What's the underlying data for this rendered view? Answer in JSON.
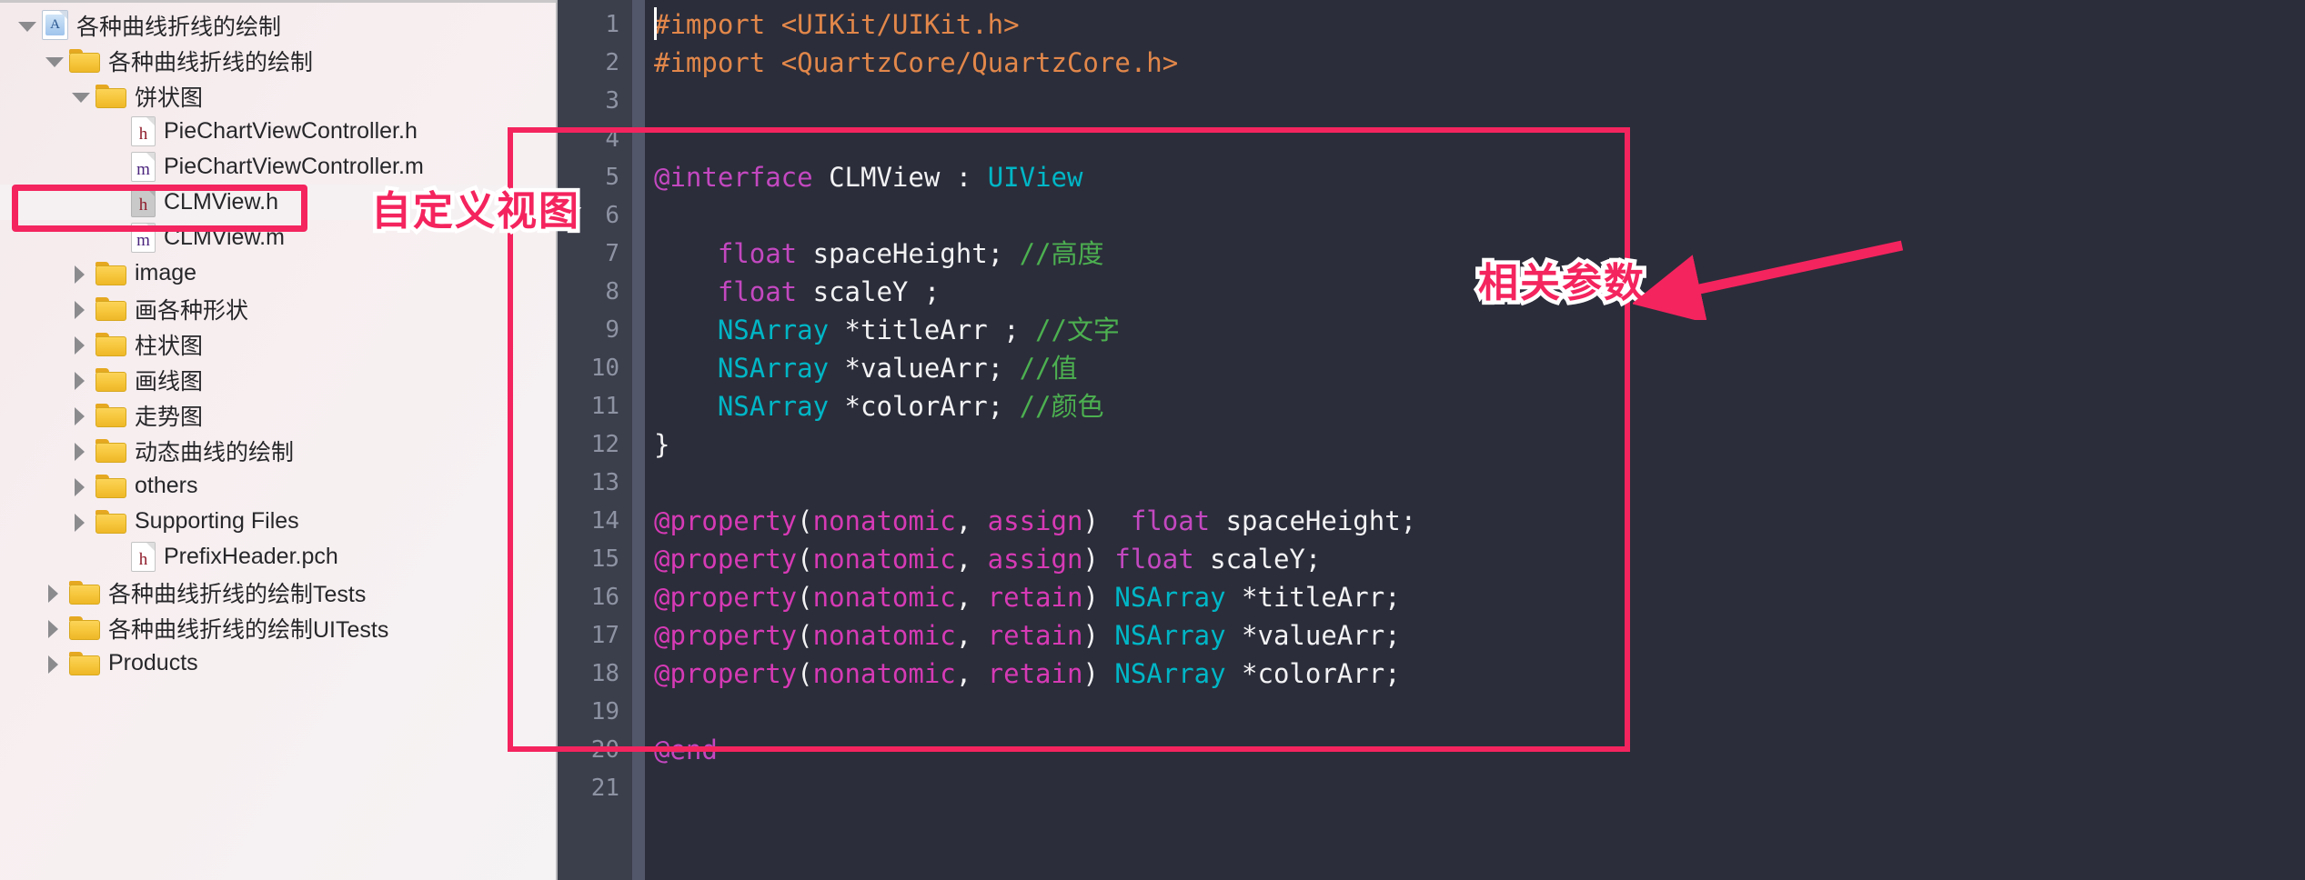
{
  "app": {
    "kind": "xcode-project-navigator-with-editor"
  },
  "sidebar": {
    "items": [
      {
        "label": "各种曲线折线的绘制",
        "icon": "project-icon",
        "indent": 0,
        "twisty": "open",
        "type": "project"
      },
      {
        "label": "各种曲线折线的绘制",
        "icon": "folder-icon",
        "indent": 1,
        "twisty": "open",
        "type": "folder"
      },
      {
        "label": "饼状图",
        "icon": "folder-icon",
        "indent": 2,
        "twisty": "open",
        "type": "folder"
      },
      {
        "label": "PieChartViewController.h",
        "icon": "header-file-icon",
        "indent": 3,
        "twisty": "none",
        "type": "file-h"
      },
      {
        "label": "PieChartViewController.m",
        "icon": "implementation-file-icon",
        "indent": 3,
        "twisty": "none",
        "type": "file-m"
      },
      {
        "label": "CLMView.h",
        "icon": "header-file-icon",
        "indent": 3,
        "twisty": "none",
        "type": "file-h-selected",
        "selected": true
      },
      {
        "label": "CLMView.m",
        "icon": "implementation-file-icon",
        "indent": 3,
        "twisty": "none",
        "type": "file-m"
      },
      {
        "label": "image",
        "icon": "folder-icon",
        "indent": 2,
        "twisty": "closed",
        "type": "folder"
      },
      {
        "label": "画各种形状",
        "icon": "folder-icon",
        "indent": 2,
        "twisty": "closed",
        "type": "folder"
      },
      {
        "label": "柱状图",
        "icon": "folder-icon",
        "indent": 2,
        "twisty": "closed",
        "type": "folder"
      },
      {
        "label": "画线图",
        "icon": "folder-icon",
        "indent": 2,
        "twisty": "closed",
        "type": "folder"
      },
      {
        "label": "走势图",
        "icon": "folder-icon",
        "indent": 2,
        "twisty": "closed",
        "type": "folder"
      },
      {
        "label": "动态曲线的绘制",
        "icon": "folder-icon",
        "indent": 2,
        "twisty": "closed",
        "type": "folder"
      },
      {
        "label": "others",
        "icon": "folder-icon",
        "indent": 2,
        "twisty": "closed",
        "type": "folder"
      },
      {
        "label": "Supporting Files",
        "icon": "folder-icon",
        "indent": 2,
        "twisty": "closed",
        "type": "folder"
      },
      {
        "label": "PrefixHeader.pch",
        "icon": "header-file-icon",
        "indent": 3,
        "twisty": "none",
        "type": "file-h"
      },
      {
        "label": "各种曲线折线的绘制Tests",
        "icon": "folder-icon",
        "indent": 1,
        "twisty": "closed",
        "type": "folder"
      },
      {
        "label": "各种曲线折线的绘制UITests",
        "icon": "folder-icon",
        "indent": 1,
        "twisty": "closed",
        "type": "folder"
      },
      {
        "label": "Products",
        "icon": "folder-icon",
        "indent": 1,
        "twisty": "closed",
        "type": "folder"
      }
    ]
  },
  "editor": {
    "line_numbers": [
      "1",
      "2",
      "3",
      "4",
      "5",
      "6",
      "7",
      "8",
      "9",
      "10",
      "11",
      "12",
      "13",
      "14",
      "15",
      "16",
      "17",
      "18",
      "19",
      "20",
      "21"
    ],
    "lines": [
      {
        "n": "1",
        "tokens": [
          {
            "t": "#import ",
            "c": "pre"
          },
          {
            "t": "<UIKit/UIKit.h>",
            "c": "pre"
          }
        ]
      },
      {
        "n": "2",
        "tokens": [
          {
            "t": "#import ",
            "c": "pre"
          },
          {
            "t": "<QuartzCore/QuartzCore.h>",
            "c": "pre"
          }
        ]
      },
      {
        "n": "3",
        "tokens": []
      },
      {
        "n": "4",
        "tokens": []
      },
      {
        "n": "5",
        "tokens": [
          {
            "t": "@interface",
            "c": "kw"
          },
          {
            "t": " ",
            "c": "plain"
          },
          {
            "t": "CLMView",
            "c": "ident"
          },
          {
            "t": " : ",
            "c": "plain"
          },
          {
            "t": "UIView",
            "c": "type"
          }
        ]
      },
      {
        "n": "6",
        "tokens": []
      },
      {
        "n": "7",
        "tokens": [
          {
            "t": "    ",
            "c": "plain"
          },
          {
            "t": "float",
            "c": "kw"
          },
          {
            "t": " spaceHeight; ",
            "c": "ident"
          },
          {
            "t": "//高度",
            "c": "cmt"
          }
        ]
      },
      {
        "n": "8",
        "tokens": [
          {
            "t": "    ",
            "c": "plain"
          },
          {
            "t": "float",
            "c": "kw"
          },
          {
            "t": " scaleY ;",
            "c": "ident"
          }
        ]
      },
      {
        "n": "9",
        "tokens": [
          {
            "t": "    ",
            "c": "plain"
          },
          {
            "t": "NSArray",
            "c": "type"
          },
          {
            "t": " *titleArr ; ",
            "c": "ident"
          },
          {
            "t": "//文字",
            "c": "cmt"
          }
        ]
      },
      {
        "n": "10",
        "tokens": [
          {
            "t": "    ",
            "c": "plain"
          },
          {
            "t": "NSArray",
            "c": "type"
          },
          {
            "t": " *valueArr; ",
            "c": "ident"
          },
          {
            "t": "//值",
            "c": "cmt"
          }
        ]
      },
      {
        "n": "11",
        "tokens": [
          {
            "t": "    ",
            "c": "plain"
          },
          {
            "t": "NSArray",
            "c": "type"
          },
          {
            "t": " *colorArr; ",
            "c": "ident"
          },
          {
            "t": "//颜色",
            "c": "cmt"
          }
        ]
      },
      {
        "n": "12",
        "tokens": [
          {
            "t": "}",
            "c": "plain"
          }
        ]
      },
      {
        "n": "13",
        "tokens": []
      },
      {
        "n": "14",
        "tokens": [
          {
            "t": "@property",
            "c": "kw2"
          },
          {
            "t": "(",
            "c": "plain"
          },
          {
            "t": "nonatomic",
            "c": "kw2"
          },
          {
            "t": ", ",
            "c": "plain"
          },
          {
            "t": "assign",
            "c": "kw2"
          },
          {
            "t": ")  ",
            "c": "plain"
          },
          {
            "t": "float",
            "c": "kw"
          },
          {
            "t": " spaceHeight;",
            "c": "ident"
          }
        ]
      },
      {
        "n": "15",
        "tokens": [
          {
            "t": "@property",
            "c": "kw2"
          },
          {
            "t": "(",
            "c": "plain"
          },
          {
            "t": "nonatomic",
            "c": "kw2"
          },
          {
            "t": ", ",
            "c": "plain"
          },
          {
            "t": "assign",
            "c": "kw2"
          },
          {
            "t": ") ",
            "c": "plain"
          },
          {
            "t": "float",
            "c": "kw"
          },
          {
            "t": " scaleY;",
            "c": "ident"
          }
        ]
      },
      {
        "n": "16",
        "tokens": [
          {
            "t": "@property",
            "c": "kw2"
          },
          {
            "t": "(",
            "c": "plain"
          },
          {
            "t": "nonatomic",
            "c": "kw2"
          },
          {
            "t": ", ",
            "c": "plain"
          },
          {
            "t": "retain",
            "c": "kw2"
          },
          {
            "t": ") ",
            "c": "plain"
          },
          {
            "t": "NSArray",
            "c": "type"
          },
          {
            "t": " *titleArr;",
            "c": "ident"
          }
        ]
      },
      {
        "n": "17",
        "tokens": [
          {
            "t": "@property",
            "c": "kw2"
          },
          {
            "t": "(",
            "c": "plain"
          },
          {
            "t": "nonatomic",
            "c": "kw2"
          },
          {
            "t": ", ",
            "c": "plain"
          },
          {
            "t": "retain",
            "c": "kw2"
          },
          {
            "t": ") ",
            "c": "plain"
          },
          {
            "t": "NSArray",
            "c": "type"
          },
          {
            "t": " *valueArr;",
            "c": "ident"
          }
        ]
      },
      {
        "n": "18",
        "tokens": [
          {
            "t": "@property",
            "c": "kw2"
          },
          {
            "t": "(",
            "c": "plain"
          },
          {
            "t": "nonatomic",
            "c": "kw2"
          },
          {
            "t": ", ",
            "c": "plain"
          },
          {
            "t": "retain",
            "c": "kw2"
          },
          {
            "t": ") ",
            "c": "plain"
          },
          {
            "t": "NSArray",
            "c": "type"
          },
          {
            "t": " *colorArr;",
            "c": "ident"
          }
        ]
      },
      {
        "n": "19",
        "tokens": []
      },
      {
        "n": "20",
        "tokens": [
          {
            "t": "@end",
            "c": "kw"
          }
        ]
      },
      {
        "n": "21",
        "tokens": []
      }
    ]
  },
  "annotations": {
    "custom_view_label": "自定义视图",
    "params_label": "相关参数",
    "accent_color": "#f4245e"
  },
  "colors": {
    "editor_background": "#2b2d3a",
    "gutter_background": "#3b3e4b",
    "sidebar_background": "#f6eef0",
    "preprocessor": "#e2874a",
    "keyword": "#c348c0",
    "property_keyword": "#d63ab5",
    "type": "#00b6c6",
    "comment": "#4cb050",
    "identifier": "#f2f2f4"
  }
}
